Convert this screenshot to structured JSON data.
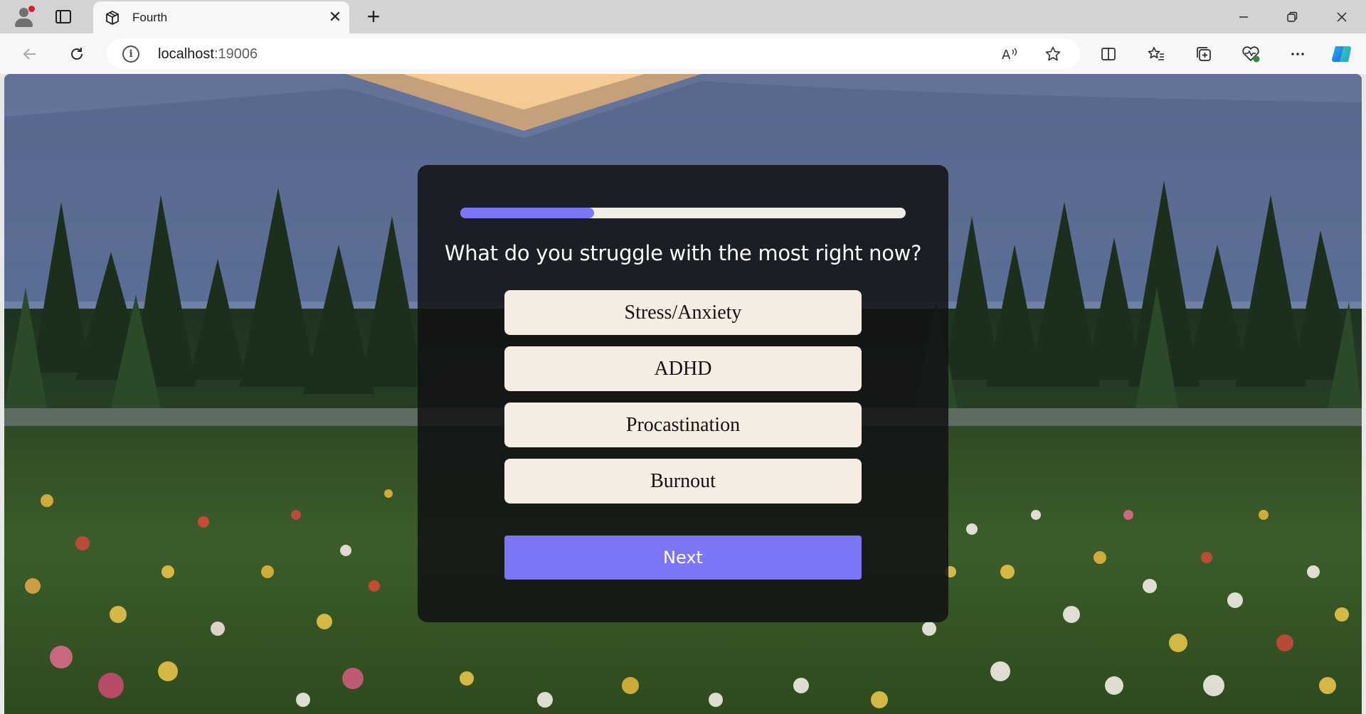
{
  "browser": {
    "tab_title": "Fourth",
    "url_host": "localhost",
    "url_port": ":19006"
  },
  "quiz": {
    "progress": 0.3,
    "question": "What do you struggle with the most right now?",
    "options": [
      "Stress/Anxiety",
      "ADHD",
      "Procastination",
      "Burnout"
    ],
    "next_label": "Next"
  },
  "colors": {
    "accent": "#7b76f5",
    "option_bg": "#f5ece2",
    "card_bg": "rgba(18,18,20,0.86)"
  },
  "icons": {
    "tabbar": [
      "profile-icon",
      "vertical-tabs-icon",
      "site-favicon",
      "close-tab-icon",
      "new-tab-icon",
      "minimize-icon",
      "restore-icon",
      "close-window-icon"
    ],
    "toolbar": [
      "back-icon",
      "refresh-icon",
      "site-info-icon",
      "read-aloud-icon",
      "favorite-star-icon",
      "split-screen-icon",
      "favorites-icon",
      "collections-icon",
      "browser-essentials-icon",
      "more-icon",
      "copilot-icon"
    ]
  }
}
